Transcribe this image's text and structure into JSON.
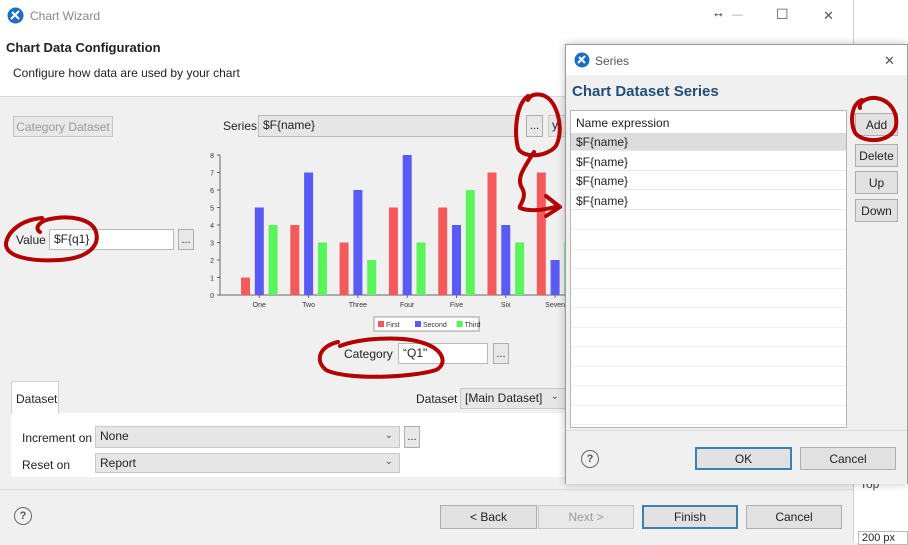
{
  "wizard": {
    "title": "Chart Wizard",
    "heading": "Chart Data Configuration",
    "description": "Configure how data are used by your chart",
    "category_dataset_label": "Category Dataset",
    "series_label": "Series",
    "series_value": "$F{name}",
    "series_side_fragment": "y",
    "value_label": "Value",
    "value_value": "$F{q1}",
    "category_label": "Category",
    "category_value": "“Q1\"",
    "ellipsis": "...",
    "dataset_tab": "Dataset",
    "dataset_label": "Dataset",
    "dataset_value": "[Main Dataset]",
    "increment_label": "Increment on",
    "increment_value": "None",
    "reset_label": "Reset on",
    "reset_value": "Report",
    "buttons": {
      "back": "< Back",
      "next": "Next >",
      "finish": "Finish",
      "cancel": "Cancel"
    },
    "side_fragments": {
      "top": "Top",
      "px": "200 px"
    },
    "window_controls": {
      "resize": "↔",
      "minimize": "—",
      "maximize": "☐",
      "close": "✕"
    }
  },
  "chart_data": {
    "type": "bar",
    "categories": [
      "One",
      "Two",
      "Three",
      "Four",
      "Five",
      "Six",
      "Seven"
    ],
    "series": [
      {
        "name": "First",
        "color": "#f55a5a",
        "values": [
          1,
          4,
          3,
          5,
          5,
          7,
          7
        ]
      },
      {
        "name": "Second",
        "color": "#5a5af5",
        "values": [
          5,
          7,
          6,
          8,
          4,
          4,
          2
        ]
      },
      {
        "name": "Third",
        "color": "#5af55a",
        "values": [
          4,
          3,
          2,
          3,
          6,
          3,
          3
        ]
      }
    ],
    "ylim": [
      0,
      8
    ],
    "yticks": [
      "0",
      "1",
      "2",
      "3",
      "4",
      "5",
      "6",
      "7",
      "8"
    ],
    "legend_position": "bottom",
    "title": "",
    "xlabel": "",
    "ylabel": ""
  },
  "series_dialog": {
    "title": "Series",
    "heading": "Chart Dataset Series",
    "column_header": "Name expression",
    "rows": [
      "$F{name}",
      "$F{name}",
      "$F{name}",
      "$F{name}"
    ],
    "buttons": {
      "add": "Add",
      "delete": "Delete",
      "up": "Up",
      "down": "Down",
      "ok": "OK",
      "cancel": "Cancel"
    },
    "close": "✕"
  },
  "colors": {
    "accent": "#1f4e79",
    "selected_row": "#dcdcdc",
    "annotation": "#b30000"
  }
}
